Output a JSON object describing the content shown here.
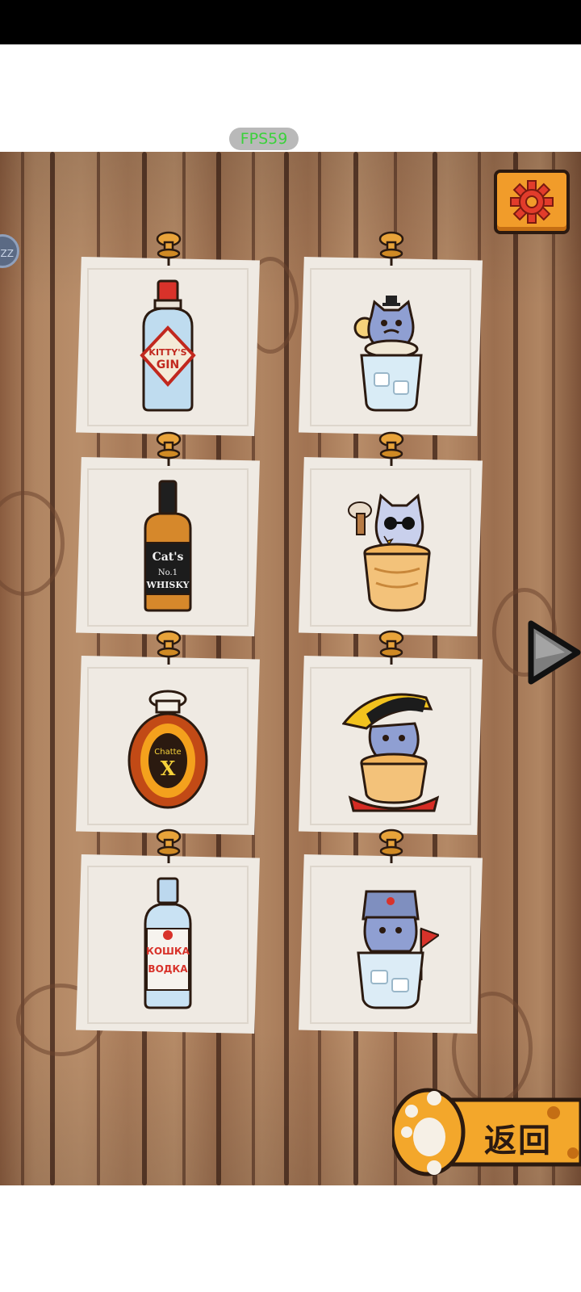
{
  "hud": {
    "fps_label": "FPS59",
    "side_bubble_text": "ZZ"
  },
  "header": {
    "settings_icon": "gear-icon"
  },
  "cards": [
    {
      "item": "gin-bottle",
      "label_lines": [
        "KITTY'S",
        "GIN"
      ]
    },
    {
      "item": "cat-in-gin-glass"
    },
    {
      "item": "whisky-bottle",
      "label_lines": [
        "Cat's",
        "No.1",
        "WHISKY"
      ]
    },
    {
      "item": "cat-in-whisky-glass"
    },
    {
      "item": "cognac-bottle",
      "label_lines": [
        "Chatte",
        "X"
      ]
    },
    {
      "item": "cat-in-cognac-glass"
    },
    {
      "item": "vodka-bottle",
      "label_lines": [
        "КОШКА",
        "ВОДКА"
      ]
    },
    {
      "item": "cat-in-vodka-glass"
    }
  ],
  "navigation": {
    "next_icon": "play-arrow-icon",
    "back_label": "返回"
  },
  "colors": {
    "wood": "#b08562",
    "accent_orange": "#f19c2a",
    "paper": "#efeae3",
    "outline": "#2b1a10"
  }
}
